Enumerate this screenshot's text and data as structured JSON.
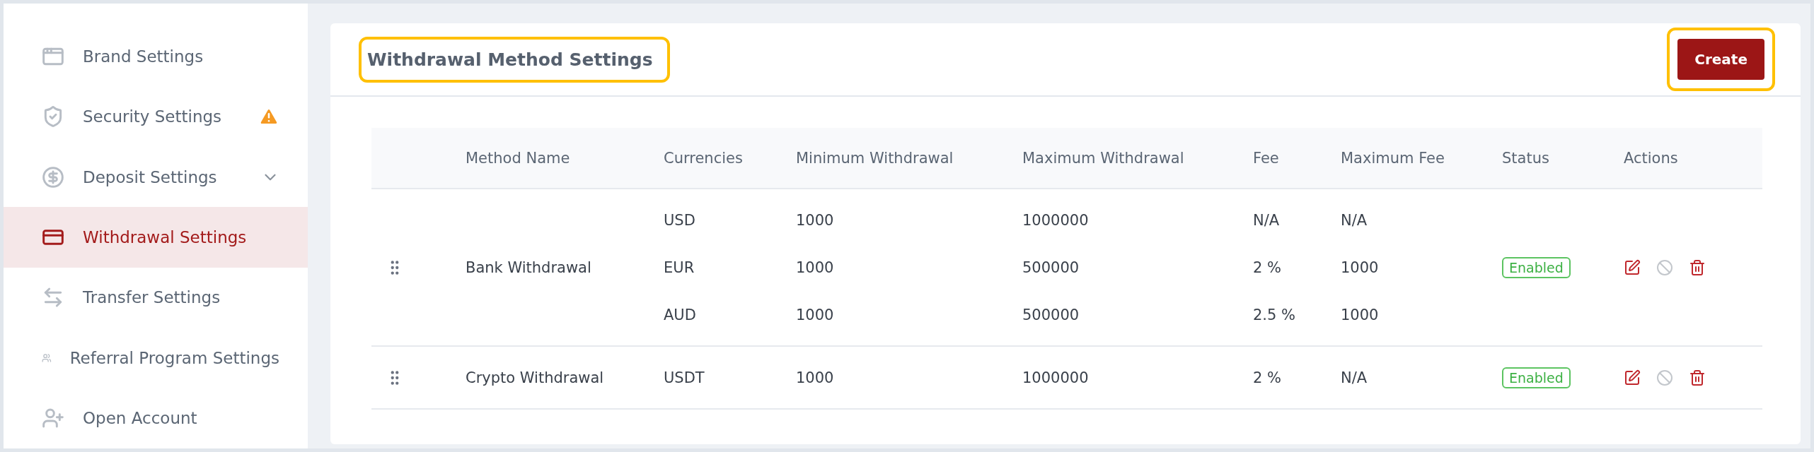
{
  "sidebar": {
    "items": [
      {
        "label": "Brand Settings",
        "selected": false
      },
      {
        "label": "Security Settings",
        "selected": false,
        "warning": true
      },
      {
        "label": "Deposit Settings",
        "selected": false,
        "expandable": true
      },
      {
        "label": "Withdrawal Settings",
        "selected": true
      },
      {
        "label": "Transfer Settings",
        "selected": false
      },
      {
        "label": "Referral Program Settings",
        "selected": false
      },
      {
        "label": "Open Account",
        "selected": false
      }
    ]
  },
  "card": {
    "title": "Withdrawal Method Settings",
    "title_highlighted": true,
    "create_button": "Create",
    "create_highlighted": true
  },
  "table": {
    "columns": [
      "Method Name",
      "Currencies",
      "Minimum Withdrawal",
      "Maximum Withdrawal",
      "Fee",
      "Maximum Fee",
      "Status",
      "Actions"
    ],
    "rows": [
      {
        "method_name": "Bank Withdrawal",
        "status": "Enabled",
        "enabled": true,
        "lines": [
          {
            "currency": "USD",
            "minimum": "1000",
            "maximum": "1000000",
            "fee": "N/A",
            "maximum_fee": "N/A"
          },
          {
            "currency": "EUR",
            "minimum": "1000",
            "maximum": "500000",
            "fee": "2 %",
            "maximum_fee": "1000"
          },
          {
            "currency": "AUD",
            "minimum": "1000",
            "maximum": "500000",
            "fee": "2.5 %",
            "maximum_fee": "1000"
          }
        ]
      },
      {
        "method_name": "Crypto Withdrawal",
        "status": "Enabled",
        "enabled": true,
        "lines": [
          {
            "currency": "USDT",
            "minimum": "1000",
            "maximum": "1000000",
            "fee": "2 %",
            "maximum_fee": "N/A"
          }
        ]
      }
    ]
  }
}
